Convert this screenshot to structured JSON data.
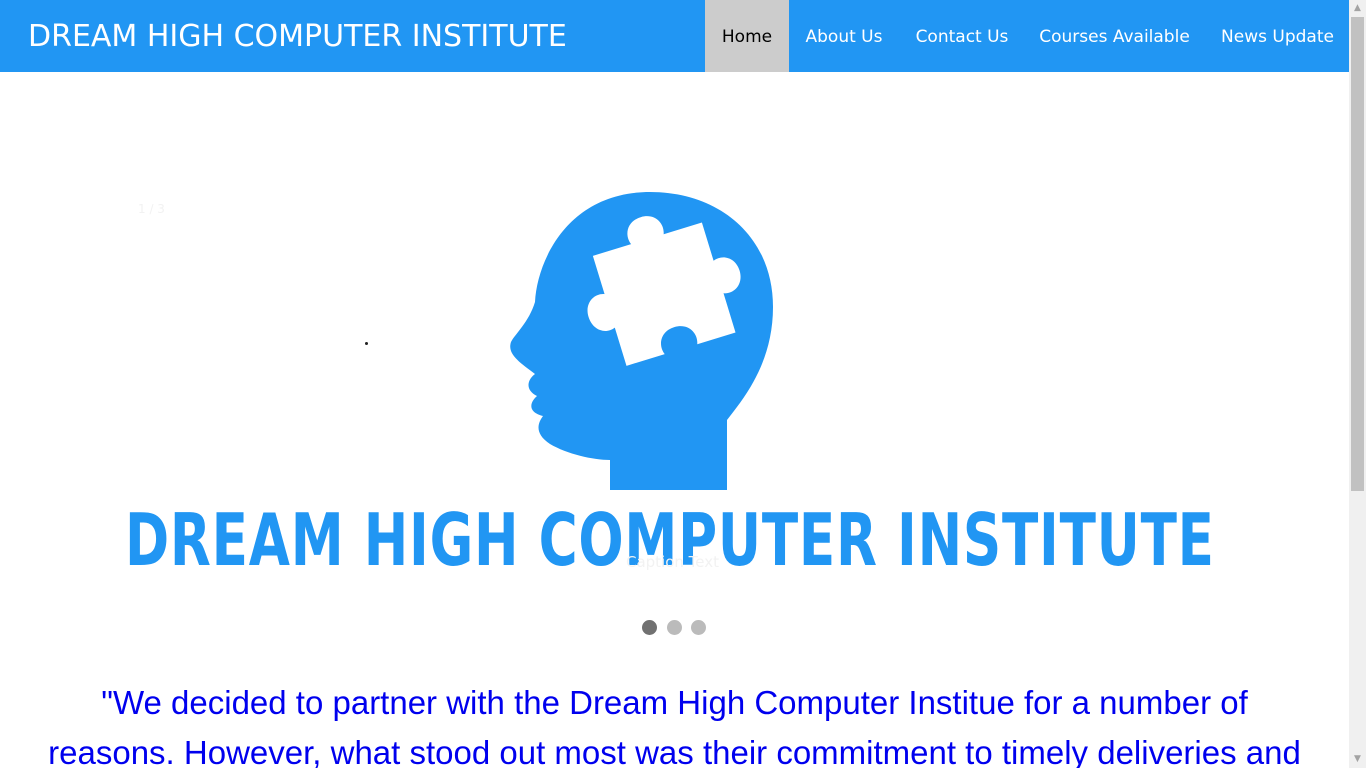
{
  "header": {
    "brand": "DREAM HIGH COMPUTER INSTITUTE",
    "nav": [
      {
        "label": "Home",
        "active": true
      },
      {
        "label": "About Us",
        "active": false
      },
      {
        "label": "Contact Us",
        "active": false
      },
      {
        "label": "Courses Available",
        "active": false
      },
      {
        "label": "News Update",
        "active": false
      }
    ]
  },
  "slideshow": {
    "number_text": "1 / 3",
    "image_banner_text": "DREAM HIGH COMPUTER INSTITUTE",
    "caption": "Caption Text",
    "current_slide": 1,
    "total_slides": 3
  },
  "quote": {
    "line1": "\"We decided to partner with the Dream High Computer Institue for a number of",
    "line2": "reasons. However, what stood out most was their commitment to timely deliveries and"
  },
  "colors": {
    "brand_blue": "#2196f3",
    "active_nav_bg": "#cccccc",
    "quote_text": "#0000ee"
  },
  "icons": {
    "logo": "head-puzzle-icon",
    "scroll_up": "arrow-up-icon",
    "scroll_down": "arrow-down-icon"
  }
}
